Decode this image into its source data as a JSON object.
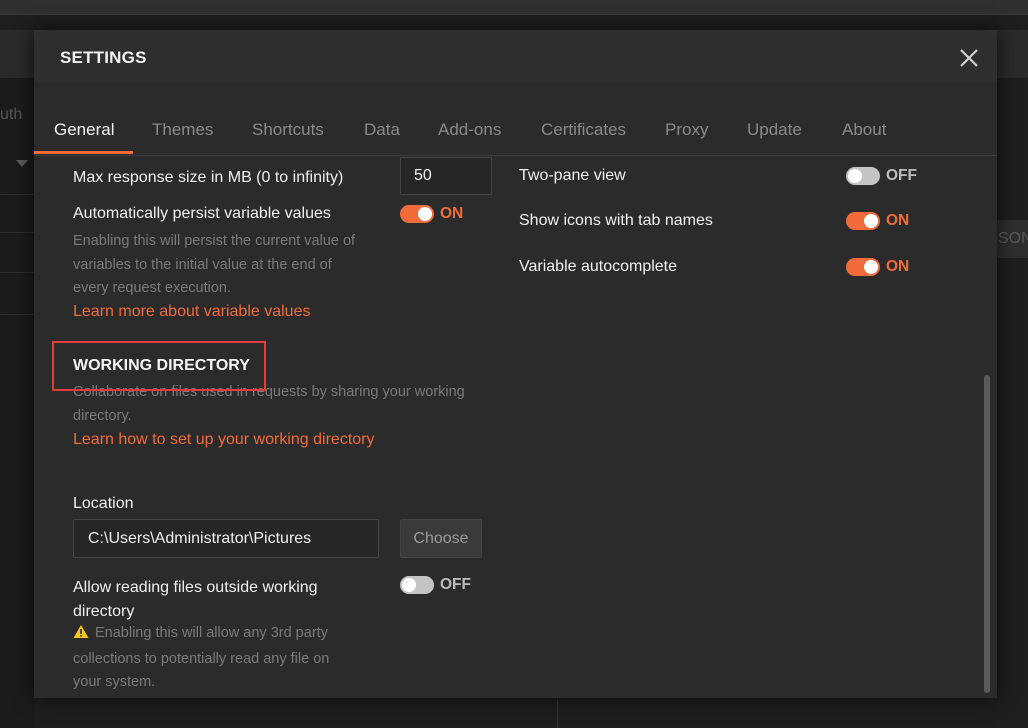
{
  "background": {
    "partial_left_text": "uth",
    "partial_right_text": "SON"
  },
  "modal": {
    "title": "SETTINGS",
    "close_icon": "close-icon"
  },
  "tabs": [
    {
      "label": "General",
      "active": true
    },
    {
      "label": "Themes",
      "active": false
    },
    {
      "label": "Shortcuts",
      "active": false
    },
    {
      "label": "Data",
      "active": false
    },
    {
      "label": "Add-ons",
      "active": false
    },
    {
      "label": "Certificates",
      "active": false
    },
    {
      "label": "Proxy",
      "active": false
    },
    {
      "label": "Update",
      "active": false
    },
    {
      "label": "About",
      "active": false
    }
  ],
  "left": {
    "max_response": {
      "label": "Max response size in MB (0 to infinity)",
      "value": "50"
    },
    "persist": {
      "label": "Automatically persist variable values",
      "state": "ON",
      "description_lines": [
        "Enabling this will persist the current value of",
        "variables to the initial value at the end of",
        "every request execution."
      ],
      "link": "Learn more about variable values"
    },
    "working_directory": {
      "heading": "WORKING DIRECTORY",
      "description_lines": [
        "Collaborate on files used in requests by sharing your working",
        "directory."
      ],
      "link": "Learn how to set up your working directory",
      "location_label": "Location",
      "location_value": "C:\\Users\\Administrator\\Pictures",
      "choose_label": "Choose"
    },
    "allow_reading": {
      "label_lines": [
        "Allow reading files outside working",
        "directory"
      ],
      "state": "OFF",
      "warning_icon": "warning-icon",
      "warning_lines": [
        "Enabling this will allow any 3rd party",
        "collections to potentially read any file on",
        "your system."
      ]
    }
  },
  "right": {
    "two_pane": {
      "label": "Two-pane view",
      "state": "OFF"
    },
    "show_icons": {
      "label": "Show icons with tab names",
      "state": "ON"
    },
    "autocomplete": {
      "label": "Variable autocomplete",
      "state": "ON"
    }
  },
  "colors": {
    "accent": "#f26b3a",
    "highlight": "#e03c3c",
    "modal_bg": "#2b2b2b",
    "warning": "#f5c518"
  }
}
